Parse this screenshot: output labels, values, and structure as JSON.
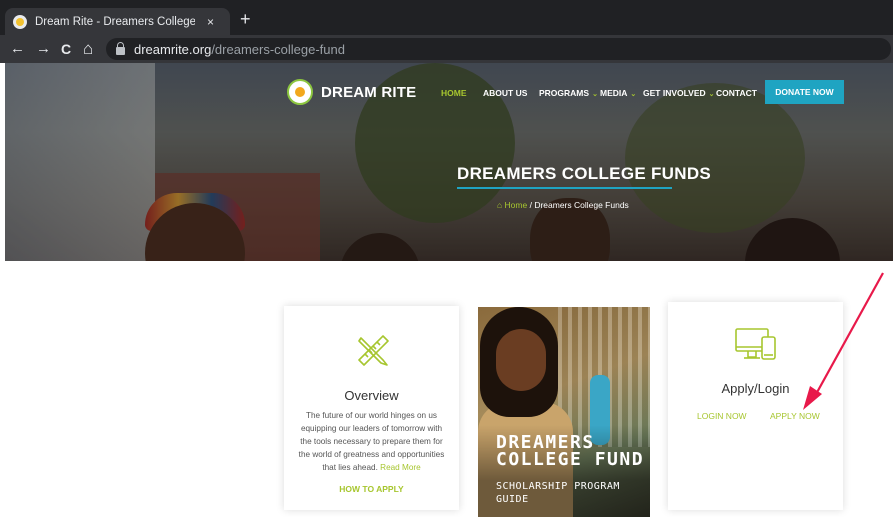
{
  "browser": {
    "tab_title": "Dream Rite - Dreamers College F",
    "tab_close": "×",
    "new_tab": "+",
    "back": "←",
    "forward": "→",
    "reload": "C",
    "home": "⌂",
    "url_host": "dreamrite.org",
    "url_path": "/dreamers-college-fund"
  },
  "site": {
    "logo_text": "DREAM RITE",
    "nav": [
      {
        "label": "HOME",
        "active": true
      },
      {
        "label": "ABOUT US"
      },
      {
        "label": "PROGRAMS",
        "dropdown": true
      },
      {
        "label": "MEDIA",
        "dropdown": true
      },
      {
        "label": "GET INVOLVED",
        "dropdown": true
      },
      {
        "label": "CONTACT"
      }
    ],
    "donate_label": "DONATE NOW",
    "accent_color": "#a7c62f",
    "button_color": "#1fa4c2"
  },
  "hero": {
    "title": "DREAMERS COLLEGE FUNDS",
    "breadcrumb_home": "Home",
    "breadcrumb_sep": "/",
    "breadcrumb_current": "Dreamers College Funds"
  },
  "overview_card": {
    "icon": "pencil-ruler-icon",
    "title": "Overview",
    "text": "The future of our world hinges on us equipping our leaders of tomorrow with the tools necessary to prepare them for the world of greatness and opportunities that lies ahead.",
    "read_more": "Read More",
    "how_to_apply": "HOW TO APPLY"
  },
  "promo_card": {
    "headline_line1": "DREAMERS",
    "headline_line2": "COLLEGE FUND",
    "subline1": "SCHOLARSHIP PROGRAM",
    "subline2": "GUIDE"
  },
  "apply_card": {
    "icon": "devices-icon",
    "title": "Apply/Login",
    "login_label": "LOGIN NOW",
    "apply_label": "APPLY NOW"
  },
  "annotation": {
    "color": "#e8194a",
    "meaning": "arrow pointing to APPLY NOW"
  }
}
